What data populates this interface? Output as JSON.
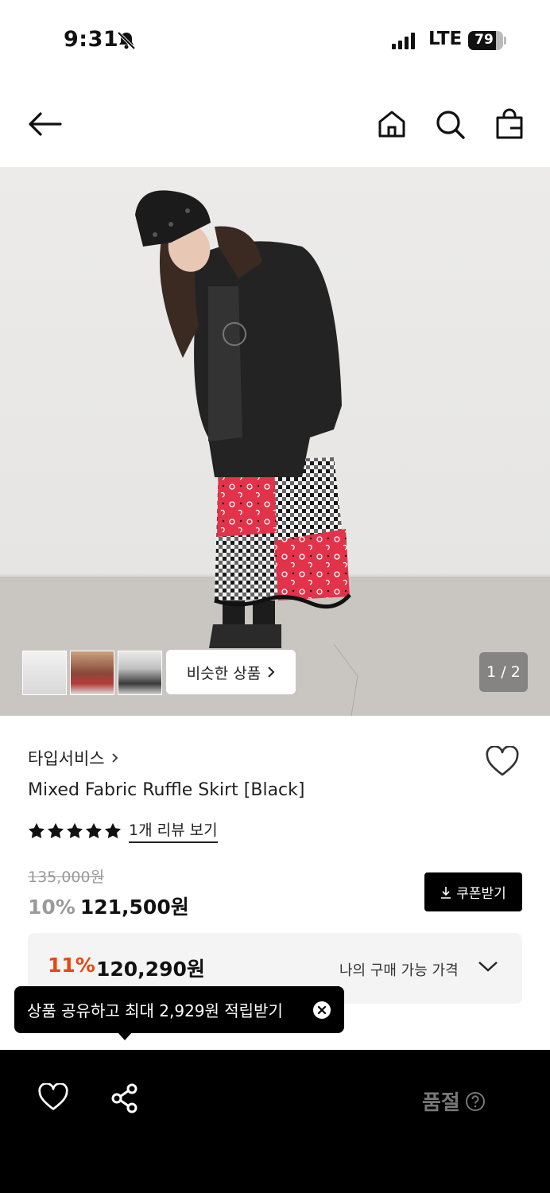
{
  "status_bar": {
    "time": "9:31",
    "network": "LTE",
    "battery": "79"
  },
  "nav": {
    "icons": [
      "back-arrow-icon",
      "home-icon",
      "search-icon",
      "shopping-bag-icon"
    ]
  },
  "gallery": {
    "similar_label": "비슷한 상품",
    "pager": "1 / 2"
  },
  "product": {
    "brand": "타입서비스",
    "title": "Mixed Fabric Ruffle Skirt [Black]",
    "rating_stars": 5,
    "review_link": "1개 리뷰 보기",
    "original_price": "135,000원",
    "discount_percent": "10%",
    "sale_price": "121,500원",
    "coupon_button": "쿠폰받기"
  },
  "my_price": {
    "percent": "11%",
    "price": "120,290원",
    "label": "나의 구매 가능 가격"
  },
  "tooltip": {
    "text": "상품 공유하고 최대 2,929원 적립받기"
  },
  "bottom_bar": {
    "status": "품절"
  },
  "colors": {
    "accent_orange": "#e8470f",
    "black": "#000000",
    "muted_gray": "#9a9a9a"
  }
}
